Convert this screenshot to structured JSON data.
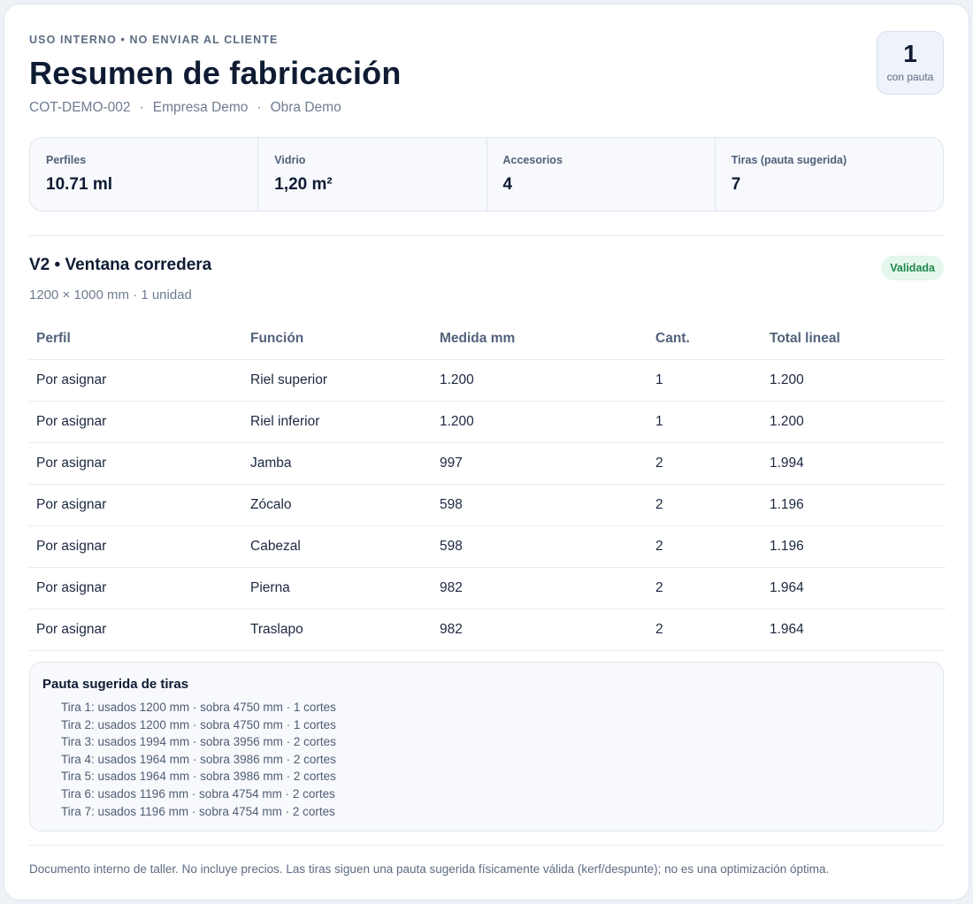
{
  "header": {
    "eyebrow": "USO INTERNO • NO ENVIAR AL CLIENTE",
    "title": "Resumen de fabricación",
    "quote_id": "COT-DEMO-002",
    "company": "Empresa Demo",
    "project": "Obra Demo",
    "separator": "·",
    "count_value": "1",
    "count_label": "con pauta"
  },
  "stats": [
    {
      "label": "Perfiles",
      "value": "10.71 ml"
    },
    {
      "label": "Vidrio",
      "value": "1,20 m²"
    },
    {
      "label": "Accesorios",
      "value": "4"
    },
    {
      "label": "Tiras (pauta sugerida)",
      "value": "7"
    }
  ],
  "section": {
    "title": "V2 • Ventana corredera",
    "subtitle": "1200 × 1000 mm · 1 unidad",
    "status": "Validada"
  },
  "table": {
    "headers": [
      "Perfil",
      "Función",
      "Medida mm",
      "Cant.",
      "Total lineal"
    ],
    "rows": [
      [
        "Por asignar",
        "Riel superior",
        "1.200",
        "1",
        "1.200"
      ],
      [
        "Por asignar",
        "Riel inferior",
        "1.200",
        "1",
        "1.200"
      ],
      [
        "Por asignar",
        "Jamba",
        "997",
        "2",
        "1.994"
      ],
      [
        "Por asignar",
        "Zócalo",
        "598",
        "2",
        "1.196"
      ],
      [
        "Por asignar",
        "Cabezal",
        "598",
        "2",
        "1.196"
      ],
      [
        "Por asignar",
        "Pierna",
        "982",
        "2",
        "1.964"
      ],
      [
        "Por asignar",
        "Traslapo",
        "982",
        "2",
        "1.964"
      ]
    ]
  },
  "pauta": {
    "title": "Pauta sugerida de tiras",
    "items": [
      "Tira 1: usados 1200 mm · sobra 4750 mm · 1 cortes",
      "Tira 2: usados 1200 mm · sobra 4750 mm · 1 cortes",
      "Tira 3: usados 1994 mm · sobra 3956 mm · 2 cortes",
      "Tira 4: usados 1964 mm · sobra 3986 mm · 2 cortes",
      "Tira 5: usados 1964 mm · sobra 3986 mm · 2 cortes",
      "Tira 6: usados 1196 mm · sobra 4754 mm · 2 cortes",
      "Tira 7: usados 1196 mm · sobra 4754 mm · 2 cortes"
    ]
  },
  "footer": "Documento interno de taller. No incluye precios. Las tiras siguen una pauta sugerida físicamente válida (kerf/despunte); no es una optimización óptima."
}
